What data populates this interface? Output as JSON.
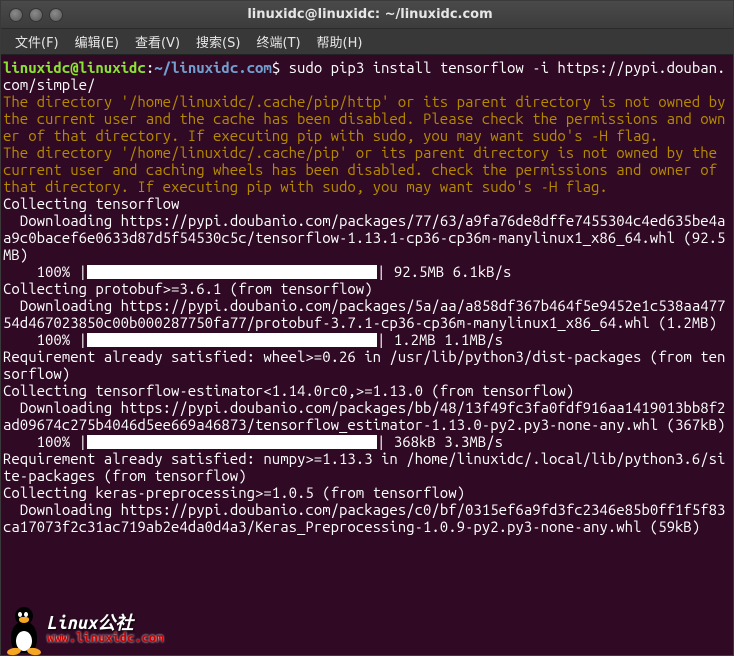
{
  "window": {
    "title": "linuxidc@linuxidc: ~/linuxidc.com"
  },
  "menu": {
    "file": "文件(F)",
    "edit": "编辑(E)",
    "view": "查看(V)",
    "search": "搜索(S)",
    "terminal": "终端(T)",
    "help": "帮助(H)"
  },
  "prompt": {
    "user_host": "linuxidc@linuxidc",
    "sep": ":",
    "path": "~/linuxidc.com",
    "dollar": "$",
    "command": " sudo pip3 install tensorflow -i https://pypi.douban.com/simple/"
  },
  "warn1": "The directory '/home/linuxidc/.cache/pip/http' or its parent directory is not owned by the current user and the cache has been disabled. Please check the permissions and owner of that directory. If executing pip with sudo, you may want sudo's -H flag.",
  "warn2": "The directory '/home/linuxidc/.cache/pip' or its parent directory is not owned by the current user and caching wheels has been disabled. check the permissions and owner of that directory. If executing pip with sudo, you may want sudo's -H flag.",
  "lines": {
    "collect_tf": "Collecting tensorflow",
    "dl_tf": "  Downloading https://pypi.doubanio.com/packages/77/63/a9fa76de8dffe7455304c4ed635be4aa9c0bacef6e0633d87d5f54530c5c/tensorflow-1.13.1-cp36-cp36m-manylinux1_x86_64.whl (92.5MB)",
    "prog_tf_pct": "    100% |",
    "prog_tf_tail": "| 92.5MB 6.1kB/s",
    "collect_proto": "Collecting protobuf>=3.6.1 (from tensorflow)",
    "dl_proto": "  Downloading https://pypi.doubanio.com/packages/5a/aa/a858df367b464f5e9452e1c538aa47754d467023850c00b000287750fa77/protobuf-3.7.1-cp36-cp36m-manylinux1_x86_64.whl (1.2MB)",
    "prog_proto_pct": "    100% |",
    "prog_proto_tail": "| 1.2MB 1.1MB/s",
    "req_wheel": "Requirement already satisfied: wheel>=0.26 in /usr/lib/python3/dist-packages (from tensorflow)",
    "collect_est": "Collecting tensorflow-estimator<1.14.0rc0,>=1.13.0 (from tensorflow)",
    "dl_est": "  Downloading https://pypi.doubanio.com/packages/bb/48/13f49fc3fa0fdf916aa1419013bb8f2ad09674c275b4046d5ee669a46873/tensorflow_estimator-1.13.0-py2.py3-none-any.whl (367kB)",
    "prog_est_pct": "    100% |",
    "prog_est_tail": "| 368kB 3.3MB/s",
    "req_numpy": "Requirement already satisfied: numpy>=1.13.3 in /home/linuxidc/.local/lib/python3.6/site-packages (from tensorflow)",
    "collect_keras": "Collecting keras-preprocessing>=1.0.5 (from tensorflow)",
    "dl_keras": "  Downloading https://pypi.doubanio.com/packages/c0/bf/0315ef6a9fd3fc2346e85b0ff1f5f83ca17073f2c31ac719ab2e4da0d4a3/Keras_Preprocessing-1.0.9-py2.py3-none-any.whl (59kB)"
  },
  "watermark": {
    "cn": "Linux公社",
    "url": "www.linuxidc.com"
  }
}
